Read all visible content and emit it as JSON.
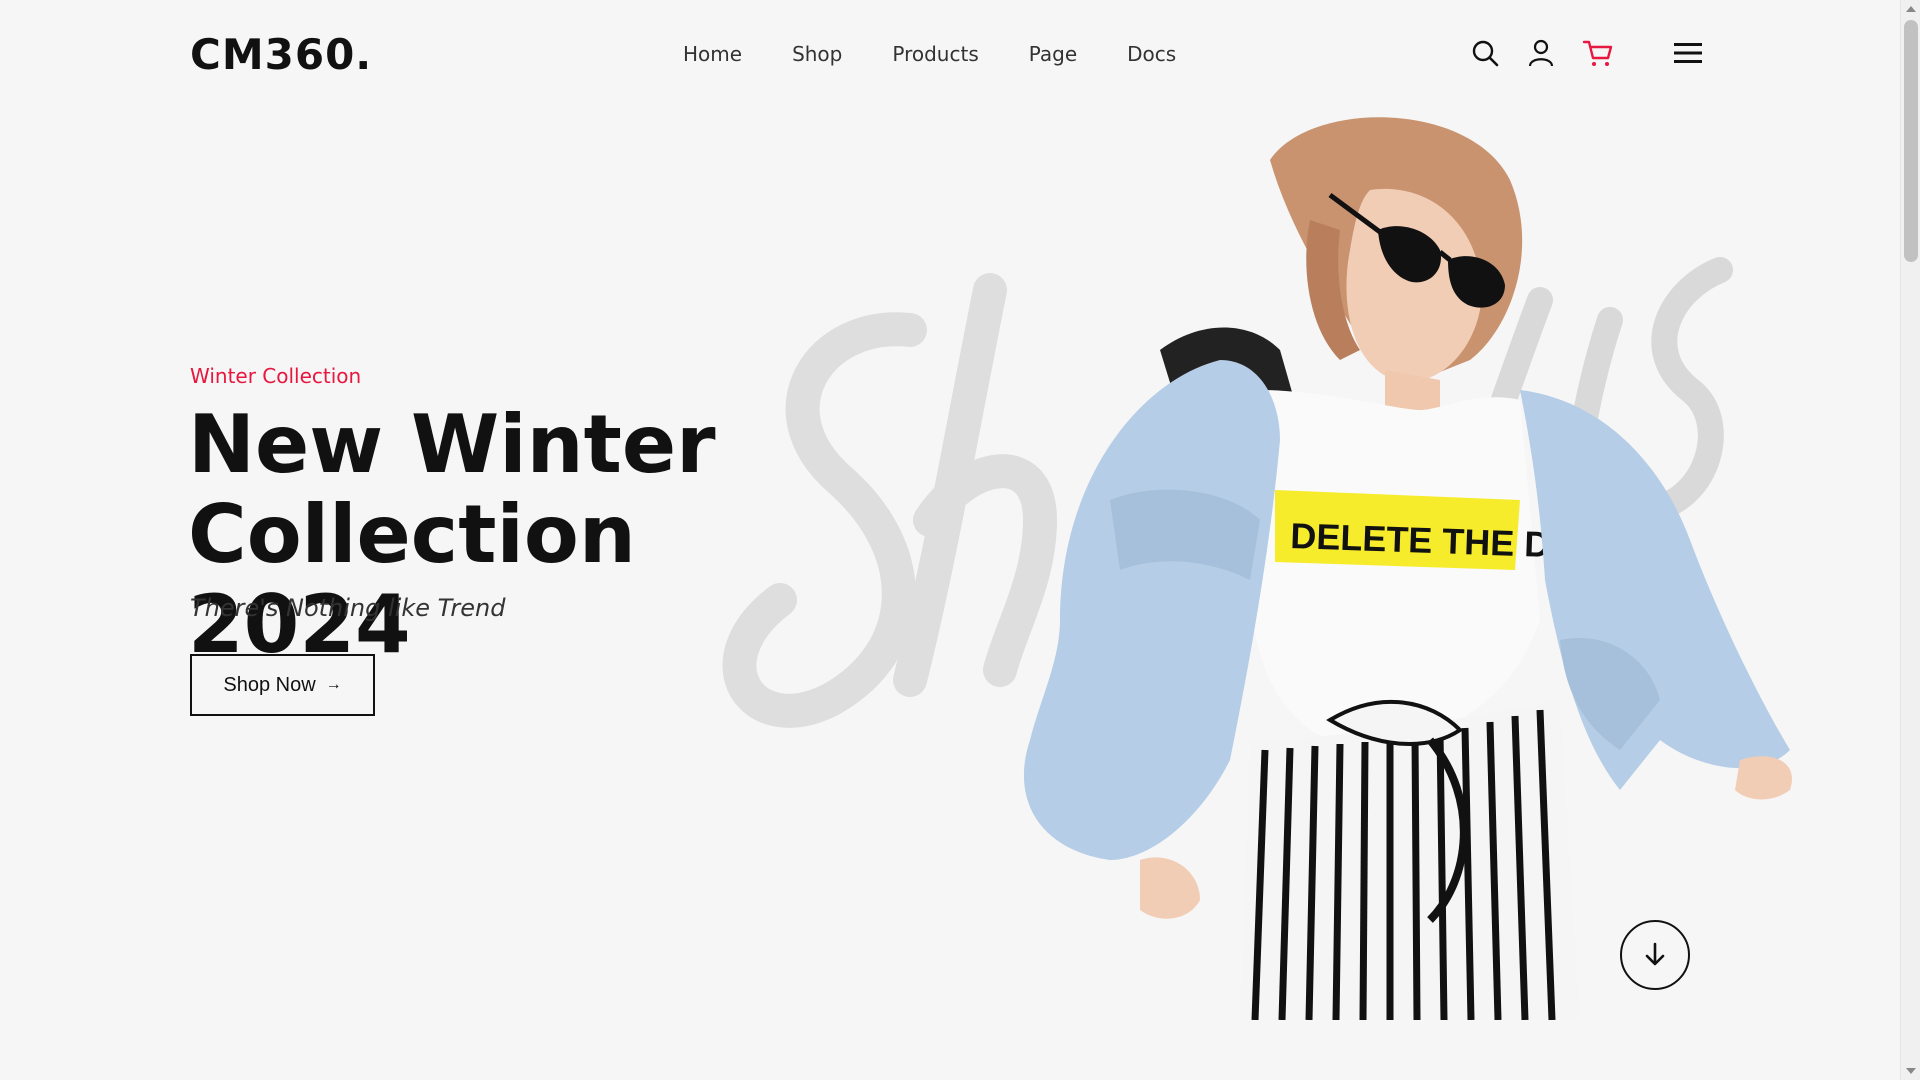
{
  "brand": {
    "logo": "CM360."
  },
  "nav": {
    "items": [
      {
        "label": "Home"
      },
      {
        "label": "Shop"
      },
      {
        "label": "Products"
      },
      {
        "label": "Page"
      },
      {
        "label": "Docs"
      }
    ]
  },
  "header_icons": [
    "search-icon",
    "user-icon",
    "cart-icon",
    "menu-icon"
  ],
  "colors": {
    "accent": "#e8173f",
    "text": "#111111",
    "background": "#f6f6f6"
  },
  "hero": {
    "eyebrow": "Winter Collection",
    "title_line1": "New Winter",
    "title_line2": "Collection 2024",
    "subtitle": "There's Nothing like Trend",
    "cta_label": "Shop Now",
    "cta_arrow": "→",
    "tee_text": "DELETE THE DRAMA"
  }
}
